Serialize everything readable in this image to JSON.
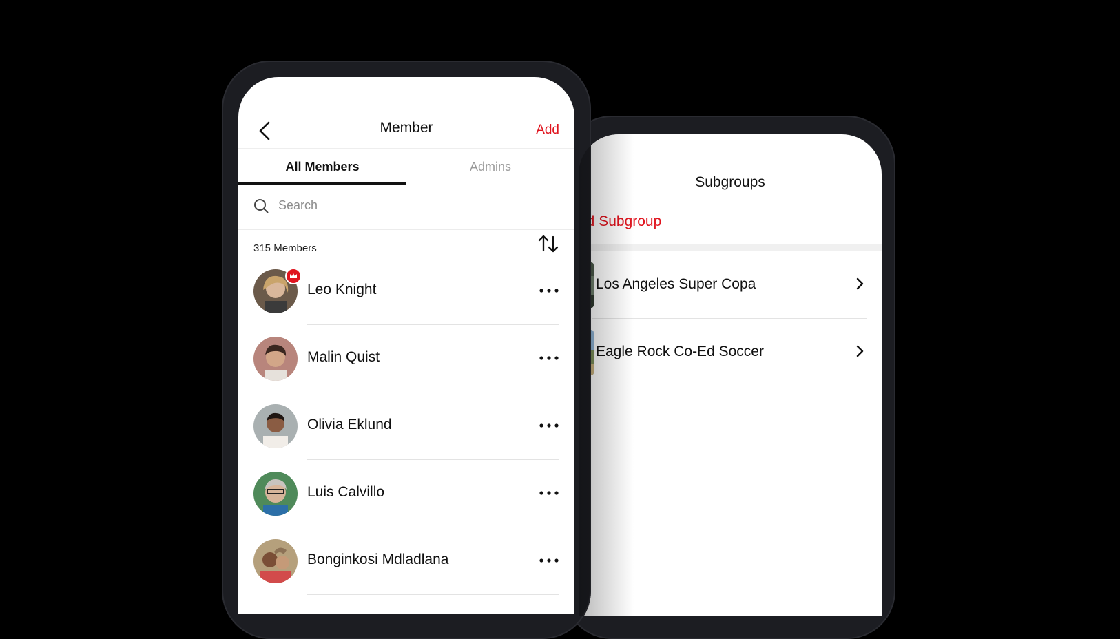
{
  "member_screen": {
    "title": "Member",
    "add_label": "Add",
    "tabs": [
      {
        "label": "All Members",
        "active": true
      },
      {
        "label": "Admins",
        "active": false
      }
    ],
    "search_placeholder": "Search",
    "member_count": "315 Members",
    "members": [
      {
        "name": "Leo Knight",
        "admin": true
      },
      {
        "name": "Malin Quist",
        "admin": false
      },
      {
        "name": "Olivia Eklund",
        "admin": false
      },
      {
        "name": "Luis Calvillo",
        "admin": false
      },
      {
        "name": "Bonginkosi Mdladlana",
        "admin": false
      }
    ]
  },
  "subgroups_screen": {
    "title": "Subgroups",
    "add_label": "Add Subgroup",
    "items": [
      {
        "name": "Los Angeles Super Copa"
      },
      {
        "name": "Eagle Rock Co-Ed Soccer"
      }
    ]
  },
  "colors": {
    "accent": "#e0141e",
    "phone_frame": "#1c1d22",
    "background": "#000000"
  }
}
